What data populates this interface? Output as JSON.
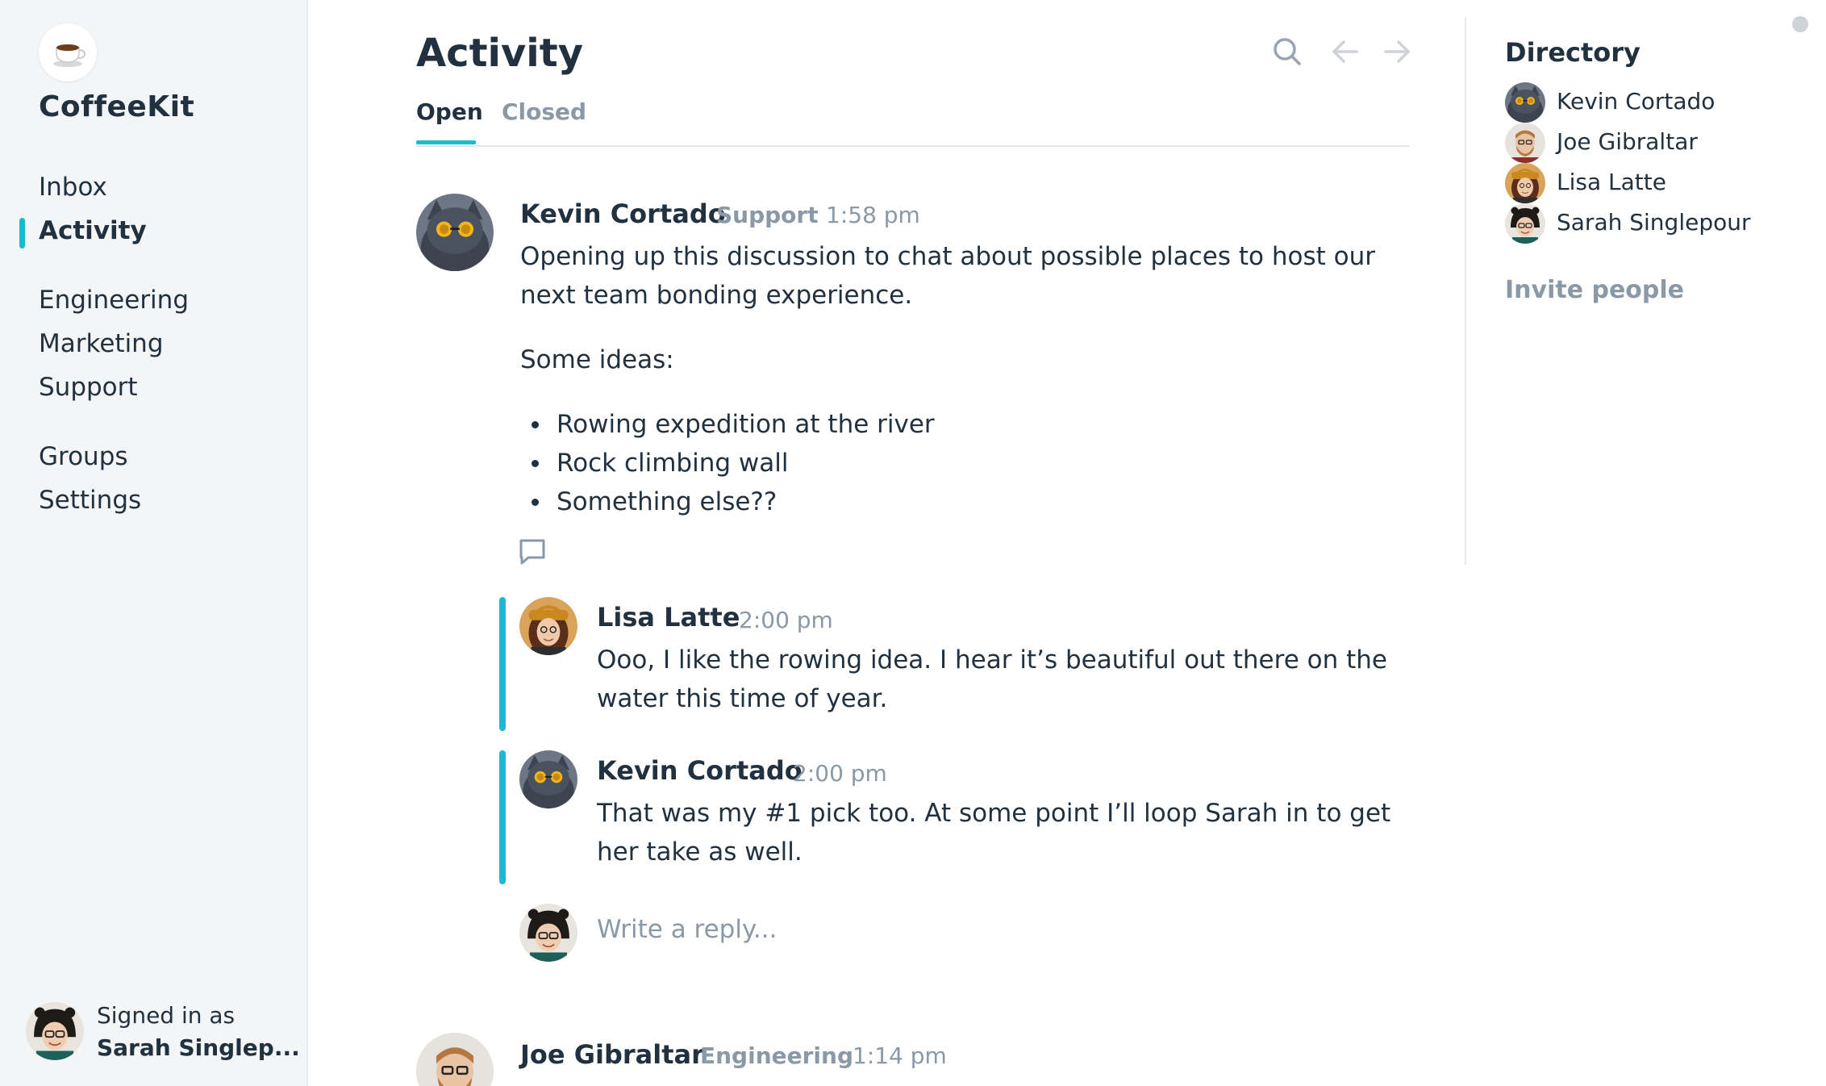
{
  "app": {
    "name": "CoffeeKit",
    "logo_icon": "coffee-cup-icon"
  },
  "sidebar": {
    "primary": [
      {
        "label": "Inbox",
        "active": false
      },
      {
        "label": "Activity",
        "active": true
      }
    ],
    "channels": [
      {
        "label": "Engineering"
      },
      {
        "label": "Marketing"
      },
      {
        "label": "Support"
      }
    ],
    "other": [
      {
        "label": "Groups"
      },
      {
        "label": "Settings"
      }
    ],
    "signed_in": {
      "caption": "Signed in as",
      "name": "Sarah Singlep..."
    }
  },
  "main": {
    "title": "Activity",
    "toolbar": {
      "search_icon": "search-icon",
      "back_icon": "arrow-left-icon",
      "forward_icon": "arrow-right-icon"
    },
    "tabs": [
      {
        "label": "Open",
        "active": true
      },
      {
        "label": "Closed",
        "active": false
      }
    ],
    "thread": {
      "author": "Kevin Cortado",
      "department": "Support",
      "time": "1:58 pm",
      "paragraph1": "Opening up this discussion to chat about possible places to host our next team bonding experience.",
      "paragraph2": "Some ideas:",
      "ideas": [
        "Rowing expedition at the river",
        "Rock climbing wall",
        "Something else??"
      ],
      "reply_icon": "comment-icon",
      "replies": [
        {
          "author": "Lisa Latte",
          "time": "2:00 pm",
          "text": "Ooo, I like the rowing idea. I hear it’s beautiful out there on the water this time of year."
        },
        {
          "author": "Kevin Cortado",
          "time": "2:00 pm",
          "text": "That was my #1 pick too. At some point I’ll loop Sarah in to get her take as well."
        }
      ],
      "reply_placeholder": "Write a reply..."
    },
    "next_thread": {
      "author": "Joe Gibraltar",
      "department": "Engineering",
      "time": "1:14 pm"
    }
  },
  "directory": {
    "title": "Directory",
    "people": [
      "Kevin Cortado",
      "Joe Gibraltar",
      "Lisa Latte",
      "Sarah Singlepour"
    ],
    "invite_label": "Invite people"
  },
  "colors": {
    "accent": "#1fb9cf",
    "text": "#22313f",
    "muted": "#8b98a5",
    "sidebar_bg": "#f3f5f6"
  }
}
